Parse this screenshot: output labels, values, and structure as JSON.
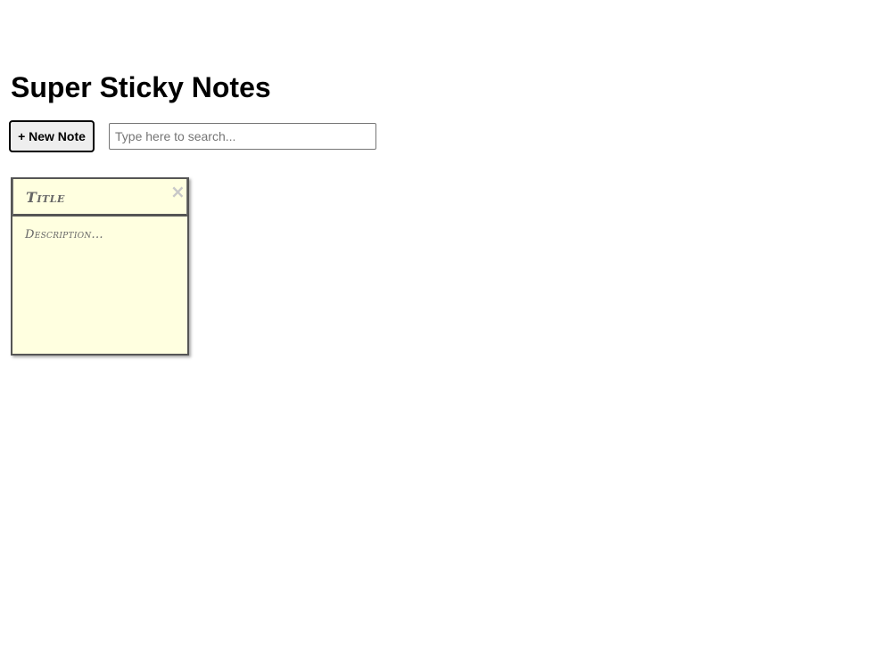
{
  "header": {
    "title": "Super Sticky Notes"
  },
  "toolbar": {
    "new_note_label": "+ New Note",
    "search_placeholder": "Type here to search...",
    "search_value": ""
  },
  "notes": [
    {
      "title": "Title",
      "description": "Description...",
      "close_icon": "close-icon",
      "close_glyph": "×"
    }
  ],
  "colors": {
    "note_background": "#ffffe0",
    "note_border": "#555555",
    "close_icon": "#c8c8c8"
  }
}
